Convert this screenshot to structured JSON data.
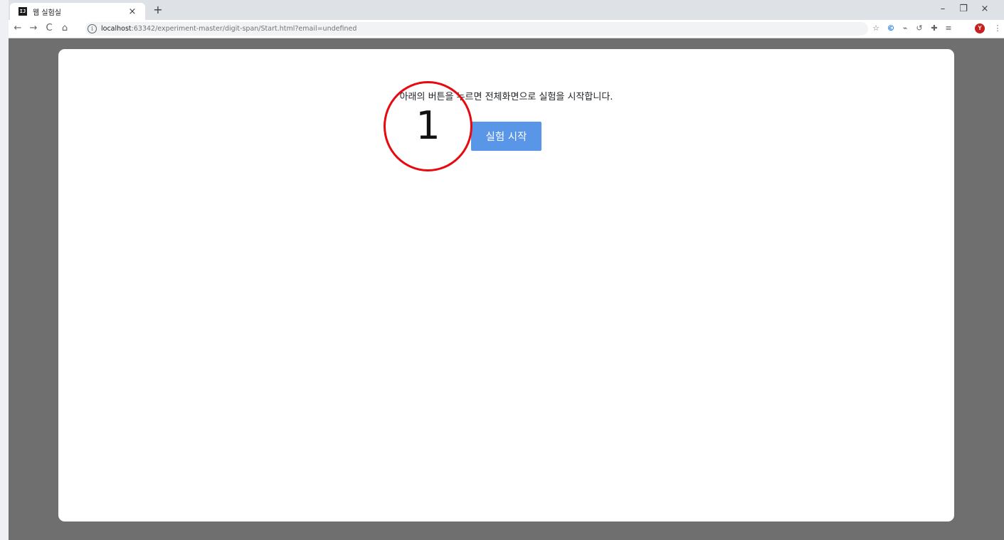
{
  "browser": {
    "tab_title": "웹 실험실",
    "tab_favicon": "IJ",
    "tab_close": "×",
    "new_tab": "+",
    "window_controls": {
      "minimize": "–",
      "restore": "❐",
      "close": "×"
    },
    "nav": {
      "back": "←",
      "forward": "→",
      "reload": "C",
      "home": "⌂"
    },
    "address_bar": {
      "info": "i",
      "host": "localhost",
      "path": ":63342/experiment-master/digit-span/Start.html?email=undefined"
    },
    "toolbar_icons": [
      "star-icon",
      "c-extension-icon",
      "pulse-extension-icon",
      "undo-extension-icon",
      "puzzle-extension-icon",
      "media-queue-icon"
    ],
    "profile_initial": "Y",
    "menu": "⋮"
  },
  "page": {
    "instruction": "아래의 버튼을 누르면 전체화면으로 실험을 시작합니다.",
    "start_button_label": "실험 시작"
  },
  "annotation": {
    "number": "1",
    "color": "#e8090e"
  },
  "colors": {
    "page_background": "#6f6f6f",
    "button": "#5a96e8"
  }
}
